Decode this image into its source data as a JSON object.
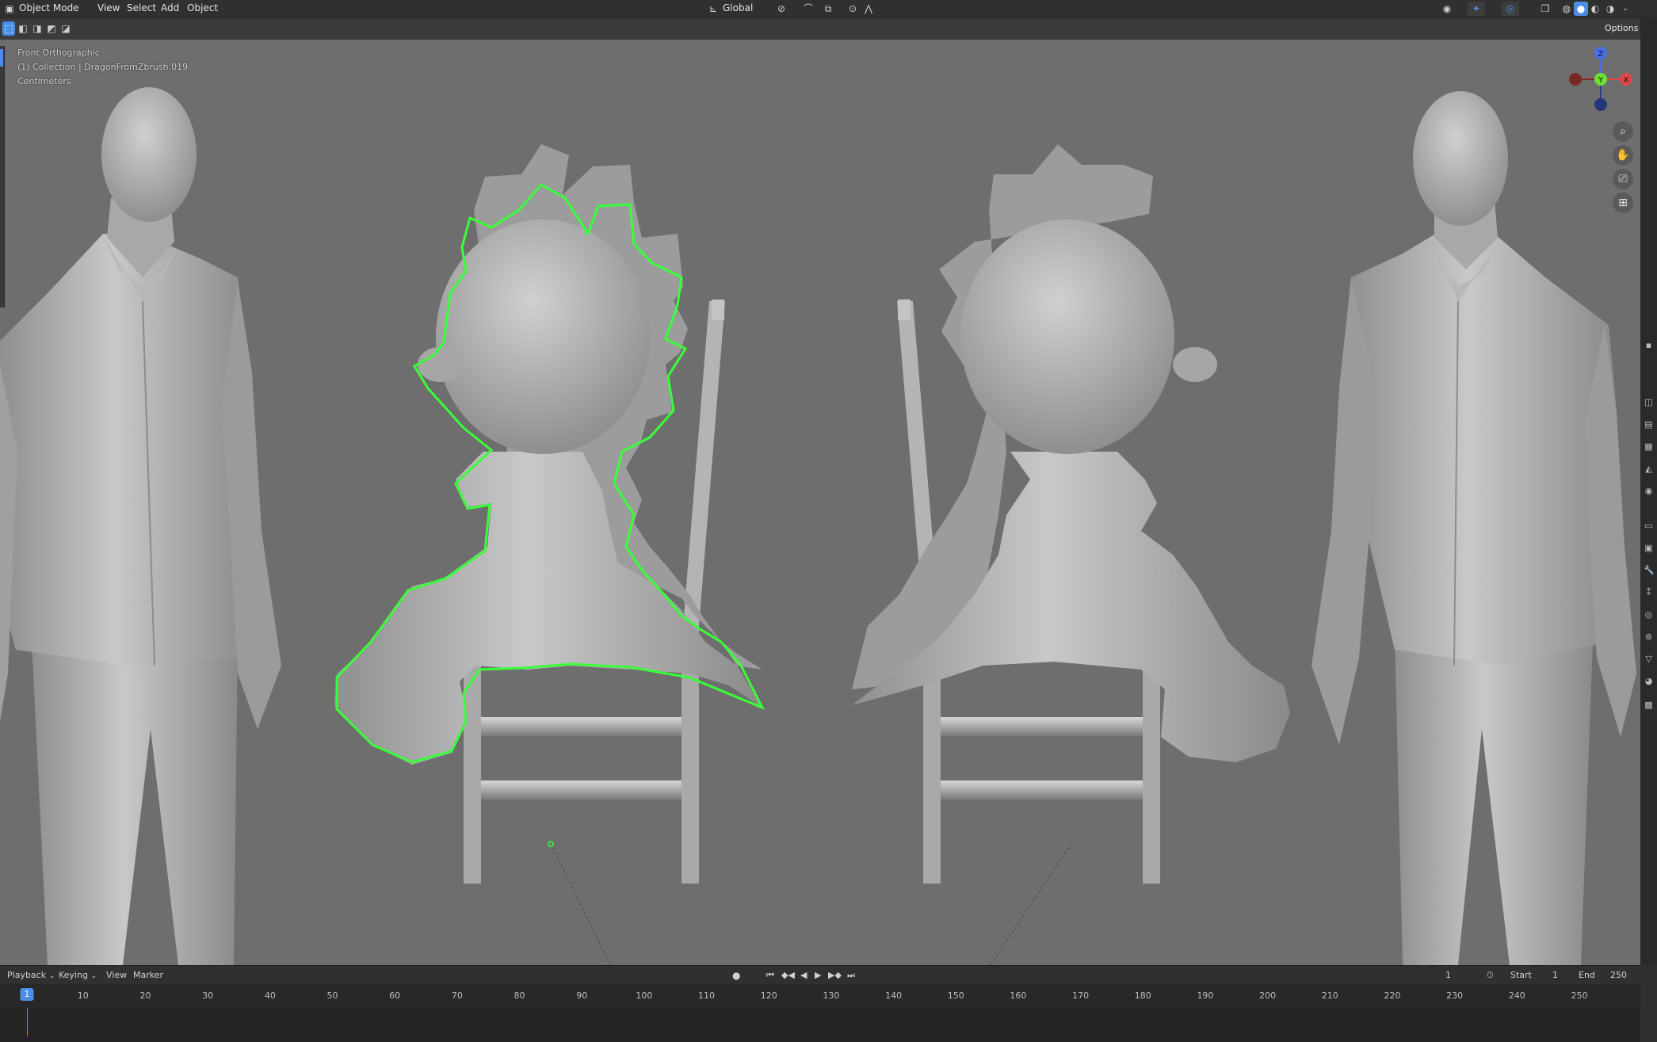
{
  "header": {
    "mode": "Object Mode",
    "menus": [
      "View",
      "Select",
      "Add",
      "Object"
    ],
    "orientation": "Global",
    "options": "Options"
  },
  "overlay": {
    "view_name": "Front Orthographic",
    "collection": "(1) Collection | DragonFromZbrush.019",
    "units": "Centimeters"
  },
  "gizmo": {
    "z": "Z",
    "y": "Y",
    "x": "X",
    "neg_x": "X"
  },
  "timeline": {
    "menus": [
      "Playback",
      "Keying",
      "View",
      "Marker"
    ],
    "current_frame": "1",
    "start_label": "Start",
    "start": "1",
    "end_label": "End",
    "end": "250",
    "ticks": [
      "1",
      "10",
      "20",
      "30",
      "40",
      "50",
      "60",
      "70",
      "80",
      "90",
      "100",
      "110",
      "120",
      "130",
      "140",
      "150",
      "160",
      "170",
      "180",
      "190",
      "200",
      "210",
      "220",
      "230",
      "240",
      "250"
    ]
  },
  "colors": {
    "selection": "#39ff39",
    "accent": "#4a8ee8",
    "x_axis": "#e04848",
    "y_axis": "#6ee030",
    "z_axis": "#4a6fe8"
  }
}
